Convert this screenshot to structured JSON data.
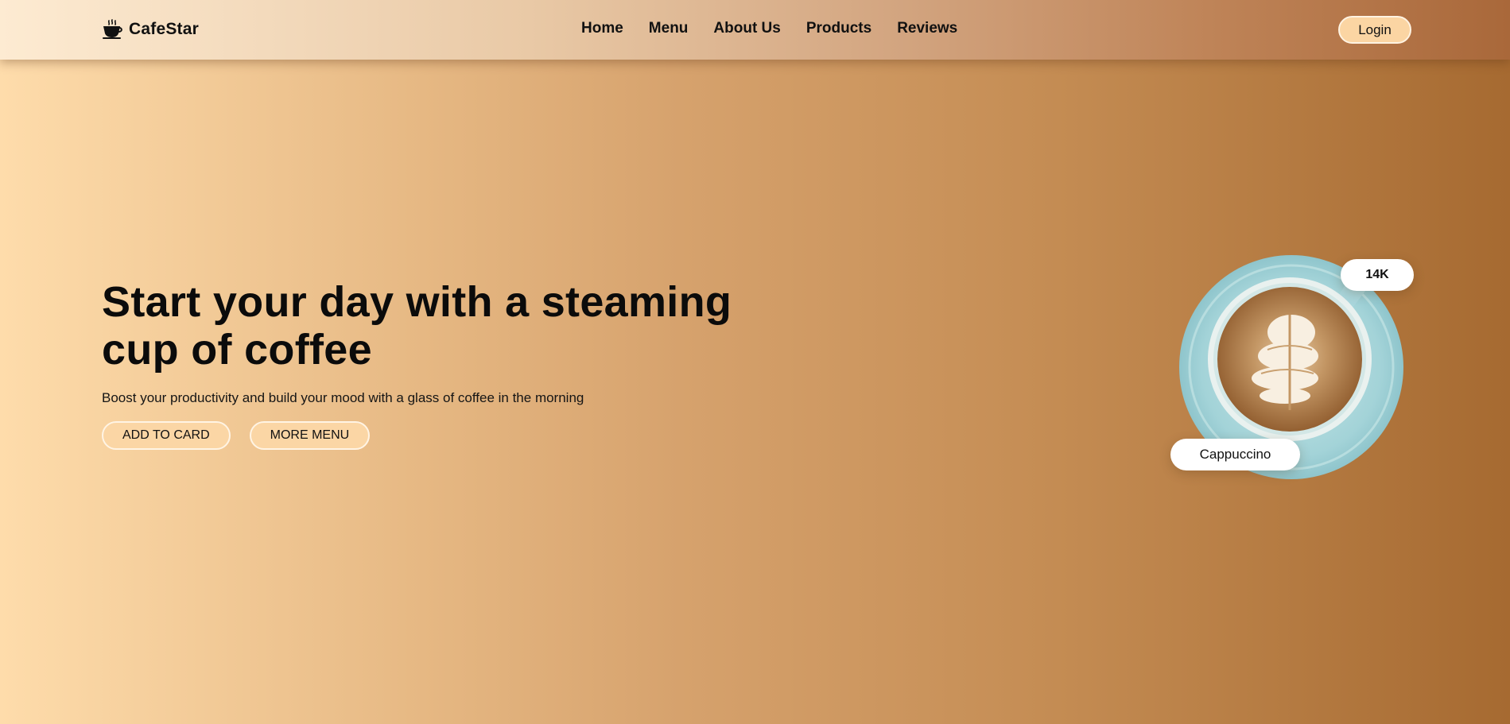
{
  "brand": {
    "name": "CafeStar",
    "icon": "coffee-cup-icon"
  },
  "nav": {
    "links": [
      "Home",
      "Menu",
      "About Us",
      "Products",
      "Reviews"
    ],
    "login_label": "Login"
  },
  "hero": {
    "title": "Start your day with a steaming cup of coffee",
    "subtitle": "Boost your productivity and build your mood with a glass of coffee in the morning",
    "buttons": {
      "add_to_card": "ADD TO CARD",
      "more_menu": "MORE MENU"
    }
  },
  "feature": {
    "count_badge": "14K",
    "product_name": "Cappuccino"
  },
  "colors": {
    "background_start": "#fedcab",
    "background_end": "#a66a31",
    "button_fill": "#fbd5a3",
    "saucer": "#a9d6d9",
    "coffee": "#b98a55"
  }
}
